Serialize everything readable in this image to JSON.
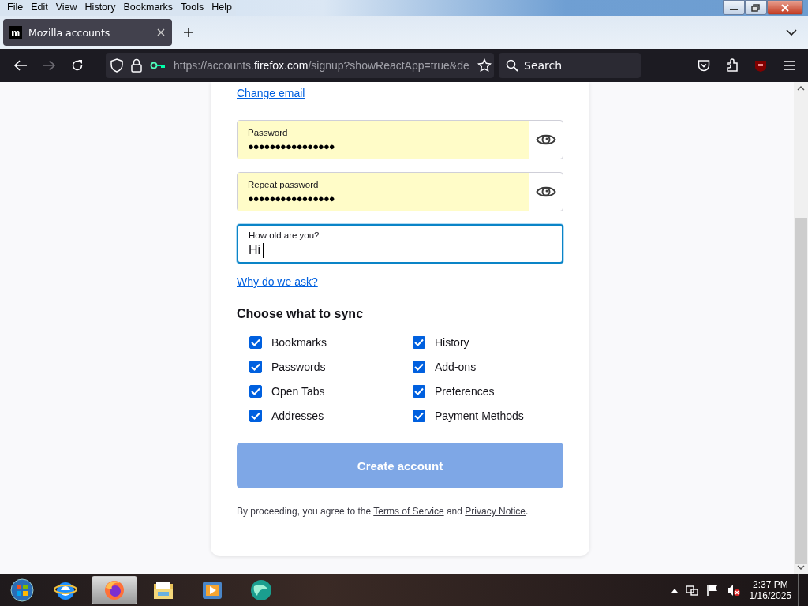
{
  "menu_bar": [
    "File",
    "Edit",
    "View",
    "History",
    "Bookmarks",
    "Tools",
    "Help"
  ],
  "tabs": [
    {
      "label": "Mozilla accounts",
      "selected": true
    }
  ],
  "address_bar": {
    "url_prefix": "https://accounts.",
    "url_domain": "firefox.com",
    "url_rest": "/signup?showReactApp=true&de"
  },
  "search": {
    "placeholder": "Search"
  },
  "form": {
    "change_email": "Change email",
    "fields": [
      {
        "kind": "password",
        "label": "Password",
        "value": "●●●●●●●●●●●●●●●●",
        "autofilled": true,
        "focused": false
      },
      {
        "kind": "password",
        "label": "Repeat password",
        "value": "●●●●●●●●●●●●●●●●",
        "autofilled": true,
        "focused": false
      },
      {
        "kind": "text",
        "label": "How old are you?",
        "value": "Hi",
        "autofilled": false,
        "focused": true
      }
    ],
    "why_link": "Why do we ask?",
    "sync_heading": "Choose what to sync",
    "sync_options": [
      {
        "label": "Bookmarks",
        "checked": true
      },
      {
        "label": "History",
        "checked": true
      },
      {
        "label": "Passwords",
        "checked": true
      },
      {
        "label": "Add-ons",
        "checked": true
      },
      {
        "label": "Open Tabs",
        "checked": true
      },
      {
        "label": "Preferences",
        "checked": true
      },
      {
        "label": "Addresses",
        "checked": true
      },
      {
        "label": "Payment Methods",
        "checked": true
      }
    ],
    "submit": {
      "label": "Create account",
      "disabled": true
    },
    "legal": {
      "prefix": "By proceeding, you agree to the ",
      "terms": "Terms of Service",
      "middle": " and ",
      "privacy": "Privacy Notice",
      "suffix": "."
    }
  },
  "taskbar": {
    "apps": [
      {
        "kind": "ie",
        "selected": false
      },
      {
        "kind": "firefox",
        "selected": true
      },
      {
        "kind": "explorer",
        "selected": false
      },
      {
        "kind": "media",
        "selected": false
      },
      {
        "kind": "globe",
        "selected": false
      }
    ],
    "time": "2:37 PM",
    "date": "1/16/2025"
  }
}
